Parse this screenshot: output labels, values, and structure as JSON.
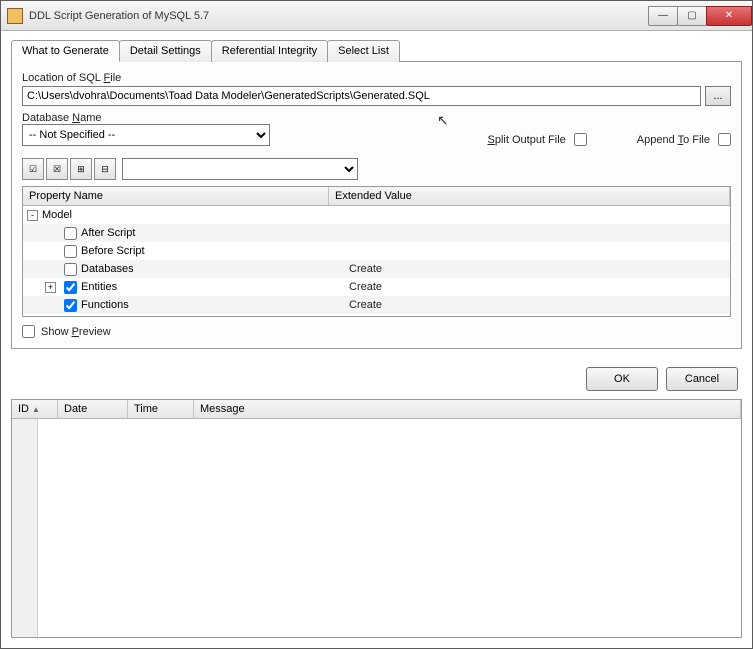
{
  "window": {
    "title": "DDL Script Generation of MySQL 5.7"
  },
  "tabs": [
    {
      "label": "What to Generate",
      "active": true
    },
    {
      "label": "Detail Settings"
    },
    {
      "label": "Referential Integrity"
    },
    {
      "label": "Select List"
    }
  ],
  "location": {
    "label_pre": "Location of SQL ",
    "label_u": "F",
    "label_post": "ile",
    "value": "C:\\Users\\dvohra\\Documents\\Toad Data Modeler\\GeneratedScripts\\Generated.SQL",
    "browse": "..."
  },
  "dbname": {
    "label_pre": "Database ",
    "label_u": "N",
    "label_post": "ame",
    "selected": "-- Not Specified --"
  },
  "split": {
    "label_u": "S",
    "label_post": "plit Output File",
    "checked": false
  },
  "append": {
    "label_pre": "Append ",
    "label_u": "T",
    "label_post": "o File",
    "checked": false
  },
  "toolbar_icons": [
    "check-all-icon",
    "uncheck-all-icon",
    "expand-all-icon",
    "collapse-all-icon"
  ],
  "grid": {
    "col_prop": "Property Name",
    "col_ext": "Extended Value",
    "rows": [
      {
        "indent": 0,
        "expander": "-",
        "checked": null,
        "label": "Model",
        "value": ""
      },
      {
        "indent": 1,
        "expander": "",
        "checked": false,
        "label": "After Script",
        "value": ""
      },
      {
        "indent": 1,
        "expander": "",
        "checked": false,
        "label": "Before Script",
        "value": ""
      },
      {
        "indent": 1,
        "expander": "",
        "checked": false,
        "label": "Databases",
        "value": "Create"
      },
      {
        "indent": 1,
        "expander": "+",
        "checked": true,
        "label": "Entities",
        "value": "Create"
      },
      {
        "indent": 1,
        "expander": "",
        "checked": true,
        "label": "Functions",
        "value": "Create"
      }
    ]
  },
  "preview": {
    "label_pre": "Show ",
    "label_u": "P",
    "label_post": "review",
    "checked": false
  },
  "buttons": {
    "ok": "OK",
    "cancel": "Cancel"
  },
  "log": {
    "cols": {
      "id": "ID",
      "date": "Date",
      "time": "Time",
      "msg": "Message"
    }
  }
}
